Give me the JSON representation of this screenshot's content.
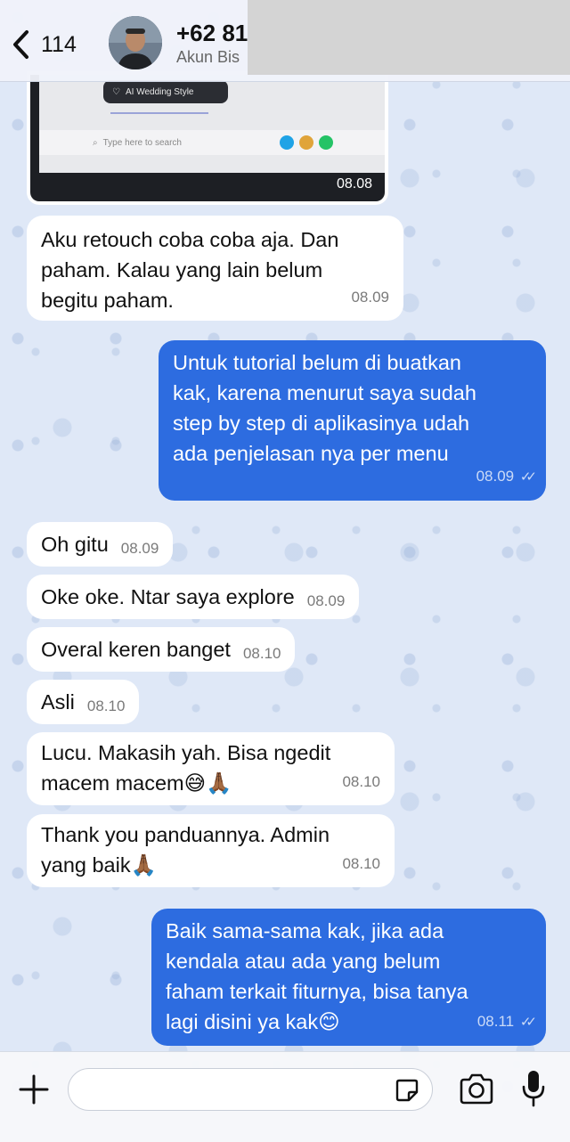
{
  "header": {
    "back_count": "114",
    "contact_name": "+62 81",
    "contact_subtitle": "Akun Bis"
  },
  "image_message": {
    "screen_label": "AI Wedding Style",
    "taskbar_search": "Type here to search",
    "time": "08.08"
  },
  "messages": [
    {
      "direction": "in",
      "text": "Aku retouch coba coba aja. Dan\npaham. Kalau yang lain belum\nbegitu paham.",
      "time": "08.09"
    },
    {
      "direction": "out",
      "text": "Untuk tutorial belum di buatkan\nkak, karena menurut saya sudah\nstep by step di aplikasinya udah\nada penjelasan nya per menu",
      "time": "08.09",
      "read": true
    },
    {
      "direction": "in",
      "text": "Oh gitu",
      "time": "08.09"
    },
    {
      "direction": "in",
      "text": "Oke oke. Ntar saya explore",
      "time": "08.09"
    },
    {
      "direction": "in",
      "text": "Overal keren banget",
      "time": "08.10"
    },
    {
      "direction": "in",
      "text": "Asli",
      "time": "08.10"
    },
    {
      "direction": "in",
      "text": "Lucu. Makasih yah. Bisa ngedit\nmacem macem😅🙏🏾",
      "time": "08.10"
    },
    {
      "direction": "in",
      "text": "Thank you panduannya. Admin\nyang baik🙏🏾",
      "time": "08.10"
    },
    {
      "direction": "out",
      "text": "Baik sama-sama kak, jika ada\nkendala atau ada yang belum\nfaham terkait fiturnya, bisa tanya\nlagi disini ya kak😊",
      "time": "08.11",
      "read": true
    }
  ],
  "composer": {
    "placeholder": ""
  },
  "colors": {
    "outgoing": "#2d6ce0",
    "incoming": "#ffffff",
    "wallpaper": "#dfe8f7"
  },
  "icons": [
    "chevron-left-icon",
    "plus-icon",
    "sticker-icon",
    "camera-icon",
    "microphone-icon",
    "double-check-icon"
  ]
}
